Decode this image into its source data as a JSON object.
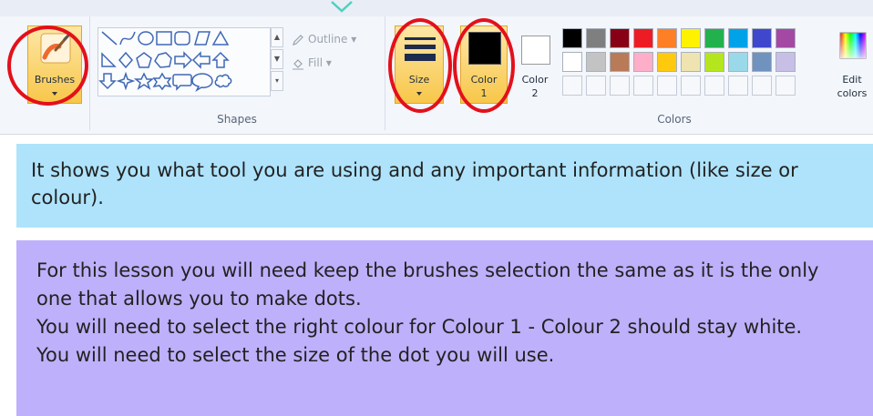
{
  "ribbon": {
    "brushes": {
      "label": "Brushes",
      "icon": "paintbrush-icon"
    },
    "shapes": {
      "group_label": "Shapes",
      "outline_label": "Outline",
      "fill_label": "Fill",
      "gallery": [
        "line",
        "curve",
        "oval",
        "rectangle",
        "rounded-rectangle",
        "polygon",
        "triangle",
        "right-triangle",
        "diamond",
        "pentagon",
        "hexagon",
        "right-arrow",
        "left-arrow",
        "up-arrow",
        "down-arrow",
        "four-point-star",
        "five-point-star",
        "six-point-star",
        "rounded-callout",
        "oval-callout",
        "cloud-callout"
      ]
    },
    "size": {
      "label": "Size",
      "icon": "line-size-icon"
    },
    "color1": {
      "label_line1": "Color",
      "label_line2": "1",
      "value": "#000000"
    },
    "color2": {
      "label_line1": "Color",
      "label_line2": "2",
      "value": "#ffffff"
    },
    "colors": {
      "group_label": "Colors",
      "row1": [
        "#000000",
        "#7f7f7f",
        "#880015",
        "#ed1c24",
        "#ff7f27",
        "#fff200",
        "#22b14c",
        "#00a2e8",
        "#3f48cc",
        "#a349a4"
      ],
      "row2": [
        "#ffffff",
        "#c3c3c3",
        "#b97a57",
        "#ffaec9",
        "#ffc90e",
        "#efe4b0",
        "#b5e61d",
        "#99d9ea",
        "#7092be",
        "#c8bfe7"
      ],
      "row3_count": 10
    },
    "edit_colors": {
      "label_line1": "Edit",
      "label_line2": "colors"
    },
    "highlight_color": "#e3101b"
  },
  "info": {
    "blue_text": "It shows you what tool you are using and any important information (like size or colour).",
    "purple_lines": [
      "For this lesson you will need keep the brushes selection the same as it is the only one that allows you to make dots.",
      "You will need to select the right colour for Colour 1 - Colour 2 should stay white.",
      "You will need to select the size of the dot you will use."
    ],
    "blue_bg": "#aee3fb",
    "purple_bg": "#bfb0fb"
  }
}
